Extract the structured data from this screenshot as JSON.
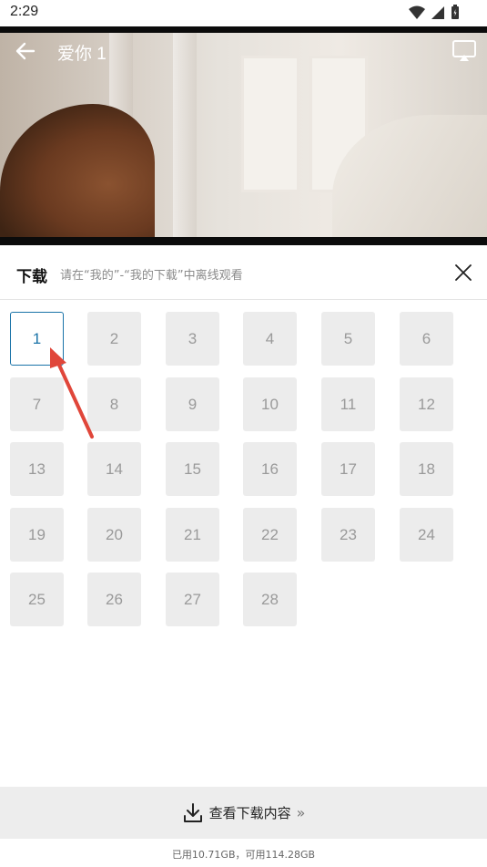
{
  "status_bar": {
    "time": "2:29"
  },
  "player": {
    "title": "爱你 1"
  },
  "download_panel": {
    "title": "下载",
    "hint": "请在“我的”-“我的下载”中离线观看"
  },
  "episodes": [
    "1",
    "2",
    "3",
    "4",
    "5",
    "6",
    "7",
    "8",
    "9",
    "10",
    "11",
    "12",
    "13",
    "14",
    "15",
    "16",
    "17",
    "18",
    "19",
    "20",
    "21",
    "22",
    "23",
    "24",
    "25",
    "26",
    "27",
    "28"
  ],
  "selected_episode": "1",
  "footer": {
    "view_downloads_label": "查看下载内容",
    "chevron": "»",
    "storage_text": "已用10.71GB，可用114.28GB"
  },
  "colors": {
    "accent": "#1a73a8",
    "annotation_arrow": "#e0463a",
    "tile_bg": "#ececec"
  }
}
